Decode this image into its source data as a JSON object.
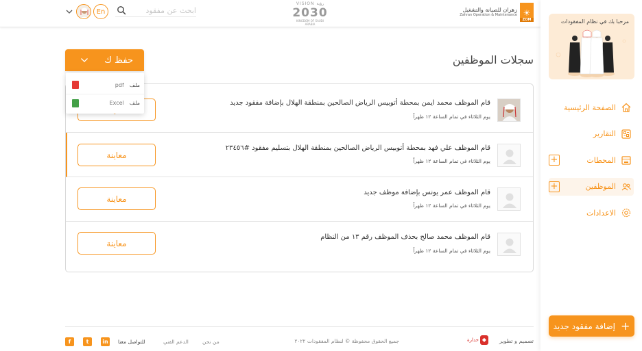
{
  "header": {
    "brand_ar": "زهران للصيانة والتشغيل",
    "brand_en": "Zahran Operation & Maintenance",
    "brand_badge": "ZOM",
    "vision_top": "VISION رؤية",
    "vision_year": "2030",
    "vision_sub": "KINGDOM OF SAUDI ARABIA",
    "search_placeholder": "ابحث عن مفقود",
    "lang": "En"
  },
  "sidebar": {
    "promo_title": "مرحبا بك في نظام المفقودات",
    "items": [
      {
        "label": "الصفحة الرئيسية",
        "icon": "home-icon"
      },
      {
        "label": "التقارير",
        "icon": "reports-icon"
      },
      {
        "label": "المحطات",
        "icon": "stations-icon"
      },
      {
        "label": "الموظفين",
        "icon": "employees-icon"
      },
      {
        "label": "الاعدادات",
        "icon": "settings-icon"
      }
    ],
    "add_button": "إضافة مفقود جديد"
  },
  "main": {
    "title": "سجلات الموظفين",
    "save_button": "حفظ ك",
    "dropdown": [
      {
        "label": "ملف",
        "type": "pdf"
      },
      {
        "label": "ملف",
        "type": "Excel"
      }
    ],
    "view_label": "معاينة",
    "logs": [
      {
        "message": "قام الموظف محمد ايمن بمحطة أتوبيس الرياض الصالحين بمنطقة الهلال بإضافة مفقود جديد",
        "time": "يوم الثلاثاء في تمام الساعة ١٢ ظهراً",
        "has_photo": true
      },
      {
        "message": "قام الموظف علي فهد بمحطة أتوبيس الرياض الصالحين بمنطقة الهلال بتسليم مفقود #٢٣٤٥٦",
        "time": "يوم الثلاثاء في تمام الساعة ١٢ ظهراً",
        "has_photo": false
      },
      {
        "message": "قام الموظف عمر يونس بإضافة موظف جديد",
        "time": "يوم الثلاثاء في تمام الساعة ١٢ ظهراً",
        "has_photo": false
      },
      {
        "message": "قام الموظف محمد صالح بحذف الموظف رقم ١٣ من النظام",
        "time": "يوم الثلاثاء في تمام الساعة ١٢ ظهراً",
        "has_photo": false
      }
    ]
  },
  "footer": {
    "design": "تصميم و تطوير",
    "logo_text": "حدارة",
    "rights": "جميع الحقوق محفوظة © لنظام المفقودات ٢٠٢٢",
    "about": "من نحن",
    "support": "الدعم الفني",
    "contact": "للتواصل معنا"
  },
  "colors": {
    "accent": "#f7941d"
  }
}
